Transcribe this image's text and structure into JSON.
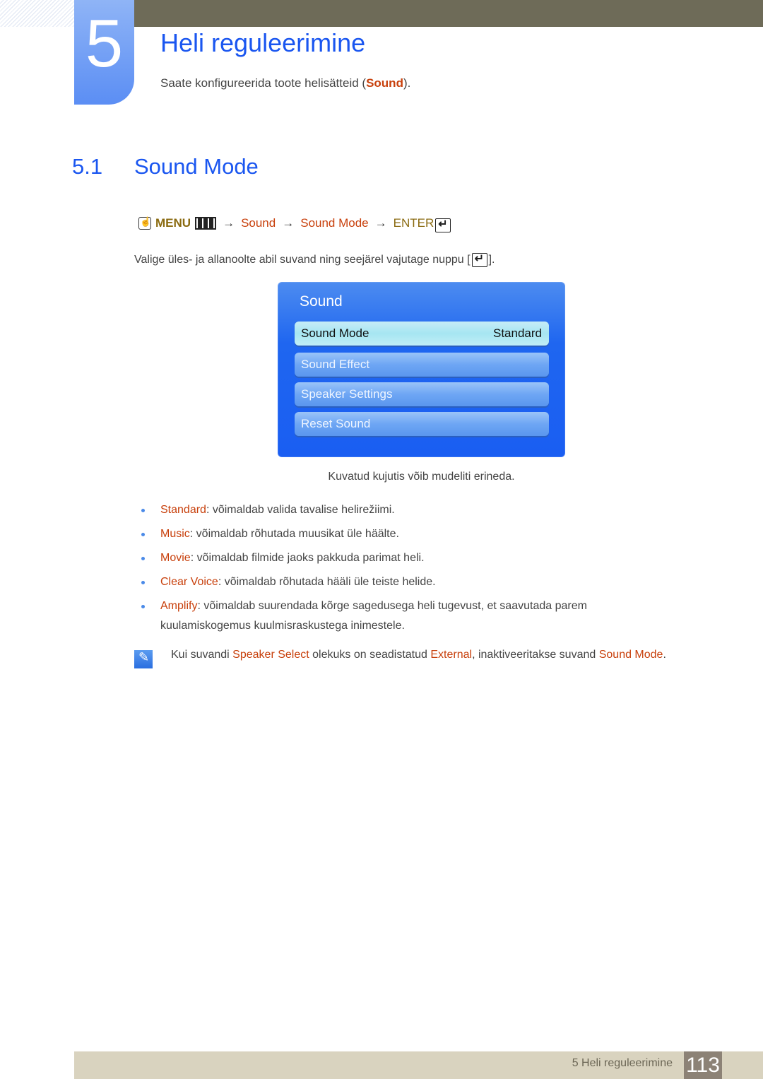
{
  "chapter": {
    "number": "5",
    "title": "Heli reguleerimine",
    "intro_prefix": "Saate konfigureerida toote helisätteid (",
    "intro_highlight": "Sound",
    "intro_suffix": ")."
  },
  "section": {
    "number": "5.1",
    "title": "Sound Mode"
  },
  "menu_path": {
    "icons": [
      "hand-remote-icon",
      "menu-icon",
      "enter-icon"
    ],
    "menu_label": "MENU",
    "arrow": "→",
    "step1": "Sound",
    "step2": "Sound Mode",
    "enter_label": "ENTER"
  },
  "instruction": {
    "text": "Valige üles- ja allanoolte abil suvand ning seejärel vajutage nuppu [",
    "suffix": "]."
  },
  "osd": {
    "title": "Sound",
    "items": [
      {
        "label": "Sound Mode",
        "value": "Standard",
        "selected": true
      },
      {
        "label": "Sound Effect",
        "value": "",
        "selected": false
      },
      {
        "label": "Speaker Settings",
        "value": "",
        "selected": false
      },
      {
        "label": "Reset Sound",
        "value": "",
        "selected": false
      }
    ]
  },
  "caption": "Kuvatud kujutis võib mudeliti erineda.",
  "bullets": [
    {
      "term": "Standard",
      "desc": ": võimaldab valida tavalise helirežiimi."
    },
    {
      "term": "Music",
      "desc": ": võimaldab rõhutada muusikat üle häälte."
    },
    {
      "term": "Movie",
      "desc": ": võimaldab filmide jaoks pakkuda parimat heli."
    },
    {
      "term": "Clear Voice",
      "desc": ": võimaldab rõhutada hääli üle teiste helide."
    },
    {
      "term": "Amplify",
      "desc": ": võimaldab suurendada kõrge sagedusega heli tugevust, et saavutada parem kuulamiskogemus kuulmisraskustega inimestele."
    }
  ],
  "note": {
    "t1": "Kui suvandi ",
    "h1": "Speaker Select",
    "t2": " olekuks on seadistatud ",
    "h2": "External",
    "t3": ", inaktiveeritakse suvand ",
    "h3": "Sound Mode",
    "t4": "."
  },
  "footer": {
    "label": "5 Heli reguleerimine",
    "page": "113"
  },
  "colors": {
    "heading_blue": "#1a56f0",
    "highlight_orange": "#c8400c",
    "menu_gold": "#8a6a10",
    "topbar": "#6e6b58",
    "footer_bg": "#d9d3bf",
    "page_box": "#8c8276"
  }
}
